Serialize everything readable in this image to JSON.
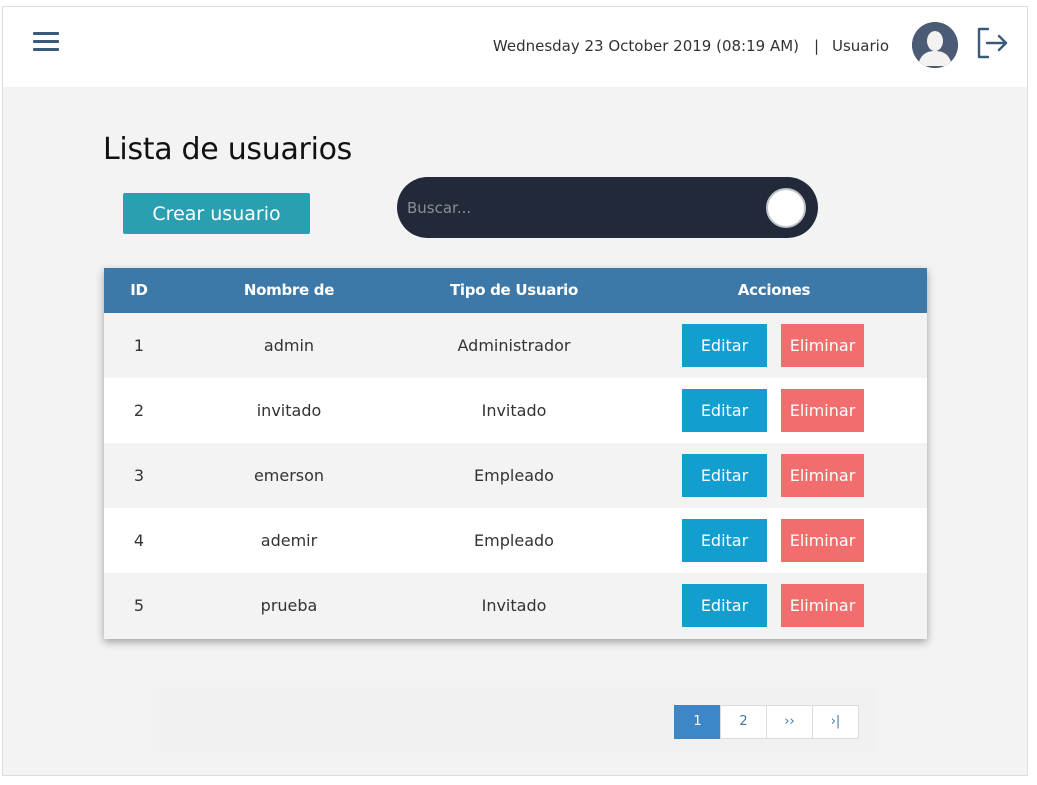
{
  "header": {
    "datetime": "Wednesday 23 October 2019 (08:19 AM)",
    "separator": "|",
    "user_label": "Usuario",
    "menu_icon": "hamburger-menu-icon",
    "avatar_icon": "user-avatar-icon",
    "logout_icon": "logout-icon"
  },
  "main": {
    "title": "Lista de usuarios",
    "create_button": "Crear usuario",
    "search_placeholder": "Buscar..."
  },
  "table": {
    "headers": [
      "ID",
      "Nombre de Usuario",
      "Tipo de Usuario",
      "Acciones"
    ],
    "rows": [
      {
        "id": "1",
        "name": "admin",
        "type": "Administrador",
        "edit": "Editar",
        "delete": "Eliminar"
      },
      {
        "id": "2",
        "name": "invitado",
        "type": "Invitado",
        "edit": "Editar",
        "delete": "Eliminar"
      },
      {
        "id": "3",
        "name": "emerson",
        "type": "Empleado",
        "edit": "Editar",
        "delete": "Eliminar"
      },
      {
        "id": "4",
        "name": "ademir",
        "type": "Empleado",
        "edit": "Editar",
        "delete": "Eliminar"
      },
      {
        "id": "5",
        "name": "prueba",
        "type": "Invitado",
        "edit": "Editar",
        "delete": "Eliminar"
      }
    ]
  },
  "pagination": {
    "pages": [
      "1",
      "2",
      "››",
      "›|"
    ],
    "active_index": 0
  },
  "colors": {
    "header_bg": "#3d79a8",
    "create_btn": "#2a9fb0",
    "edit_btn": "#129fd0",
    "delete_btn": "#f26d6d",
    "search_bg": "#222a3a",
    "page_active": "#3d86c8"
  }
}
